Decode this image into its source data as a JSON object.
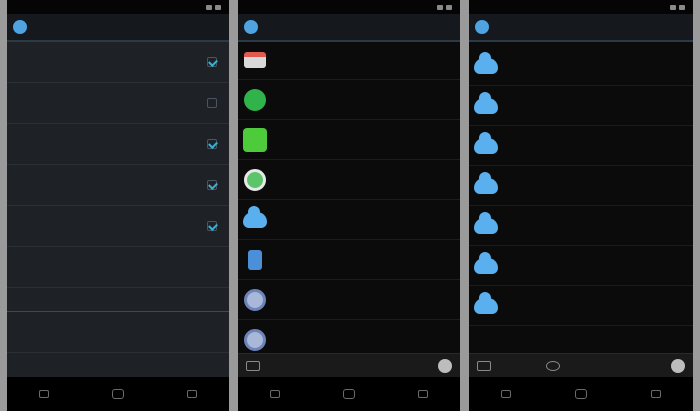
{
  "screens": [
    {
      "type": "settings",
      "items": [
        {
          "title": "",
          "summary": "",
          "checked": true
        },
        {
          "title": "",
          "summary": "",
          "checked": false
        },
        {
          "title": "",
          "summary": "",
          "checked": true
        },
        {
          "title": "",
          "summary": "",
          "checked": true
        },
        {
          "title": "",
          "summary": "",
          "checked": true
        },
        {
          "title": "",
          "summary": "",
          "checked": false
        }
      ]
    },
    {
      "type": "app-list",
      "apps": [
        {
          "icon": "gmail-icon",
          "name": "",
          "sub": "",
          "right": ""
        },
        {
          "icon": "spotify-icon",
          "name": "",
          "sub": "",
          "right": ""
        },
        {
          "icon": "line-icon",
          "name": "",
          "sub": "",
          "right": ""
        },
        {
          "icon": "whatsapp-icon",
          "name": "",
          "sub": "",
          "right": ""
        },
        {
          "icon": "cloud-icon",
          "name": "",
          "sub": "",
          "right": ""
        },
        {
          "icon": "lock-icon",
          "name": "",
          "sub": "",
          "right": ""
        },
        {
          "icon": "sync-icon",
          "name": "",
          "sub": "",
          "right": ""
        },
        {
          "icon": "sync-icon",
          "name": "",
          "sub": "",
          "right": ""
        }
      ]
    },
    {
      "type": "cloud-list",
      "count": 8
    }
  ],
  "colors": {
    "accent": "#3db0d0",
    "cloud": "#5ab0ee",
    "settings_bg": "#1e2227",
    "list_bg": "#0b0b0b"
  }
}
